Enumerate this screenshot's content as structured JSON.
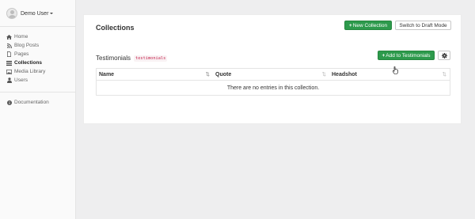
{
  "sidebar": {
    "user_name": "Demo User",
    "user_menu_icon": "chevron-down-icon",
    "items": [
      {
        "label": "Home",
        "icon": "home-icon"
      },
      {
        "label": "Blog Posts",
        "icon": "rss-icon"
      },
      {
        "label": "Pages",
        "icon": "file-icon"
      },
      {
        "label": "Collections",
        "icon": "list-icon",
        "active": true
      },
      {
        "label": "Media Library",
        "icon": "image-icon"
      },
      {
        "label": "Users",
        "icon": "user-icon"
      }
    ],
    "documentation": {
      "label": "Documentation",
      "icon": "info-icon"
    }
  },
  "main": {
    "title": "Collections",
    "new_collection_label": "New Collection",
    "draft_mode_label": "Switch to Draft Mode",
    "collection": {
      "name": "Testimonials",
      "slug": "testimonials",
      "add_label": "Add to Testimonials",
      "settings_icon": "gear-icon"
    },
    "table": {
      "columns": [
        "Name",
        "Quote",
        "Headshot"
      ],
      "empty_message": "There are no entries in this collection."
    }
  },
  "colors": {
    "accent_green": "#2d9a4c",
    "code_text": "#c7254e",
    "background": "#eeeeef"
  }
}
